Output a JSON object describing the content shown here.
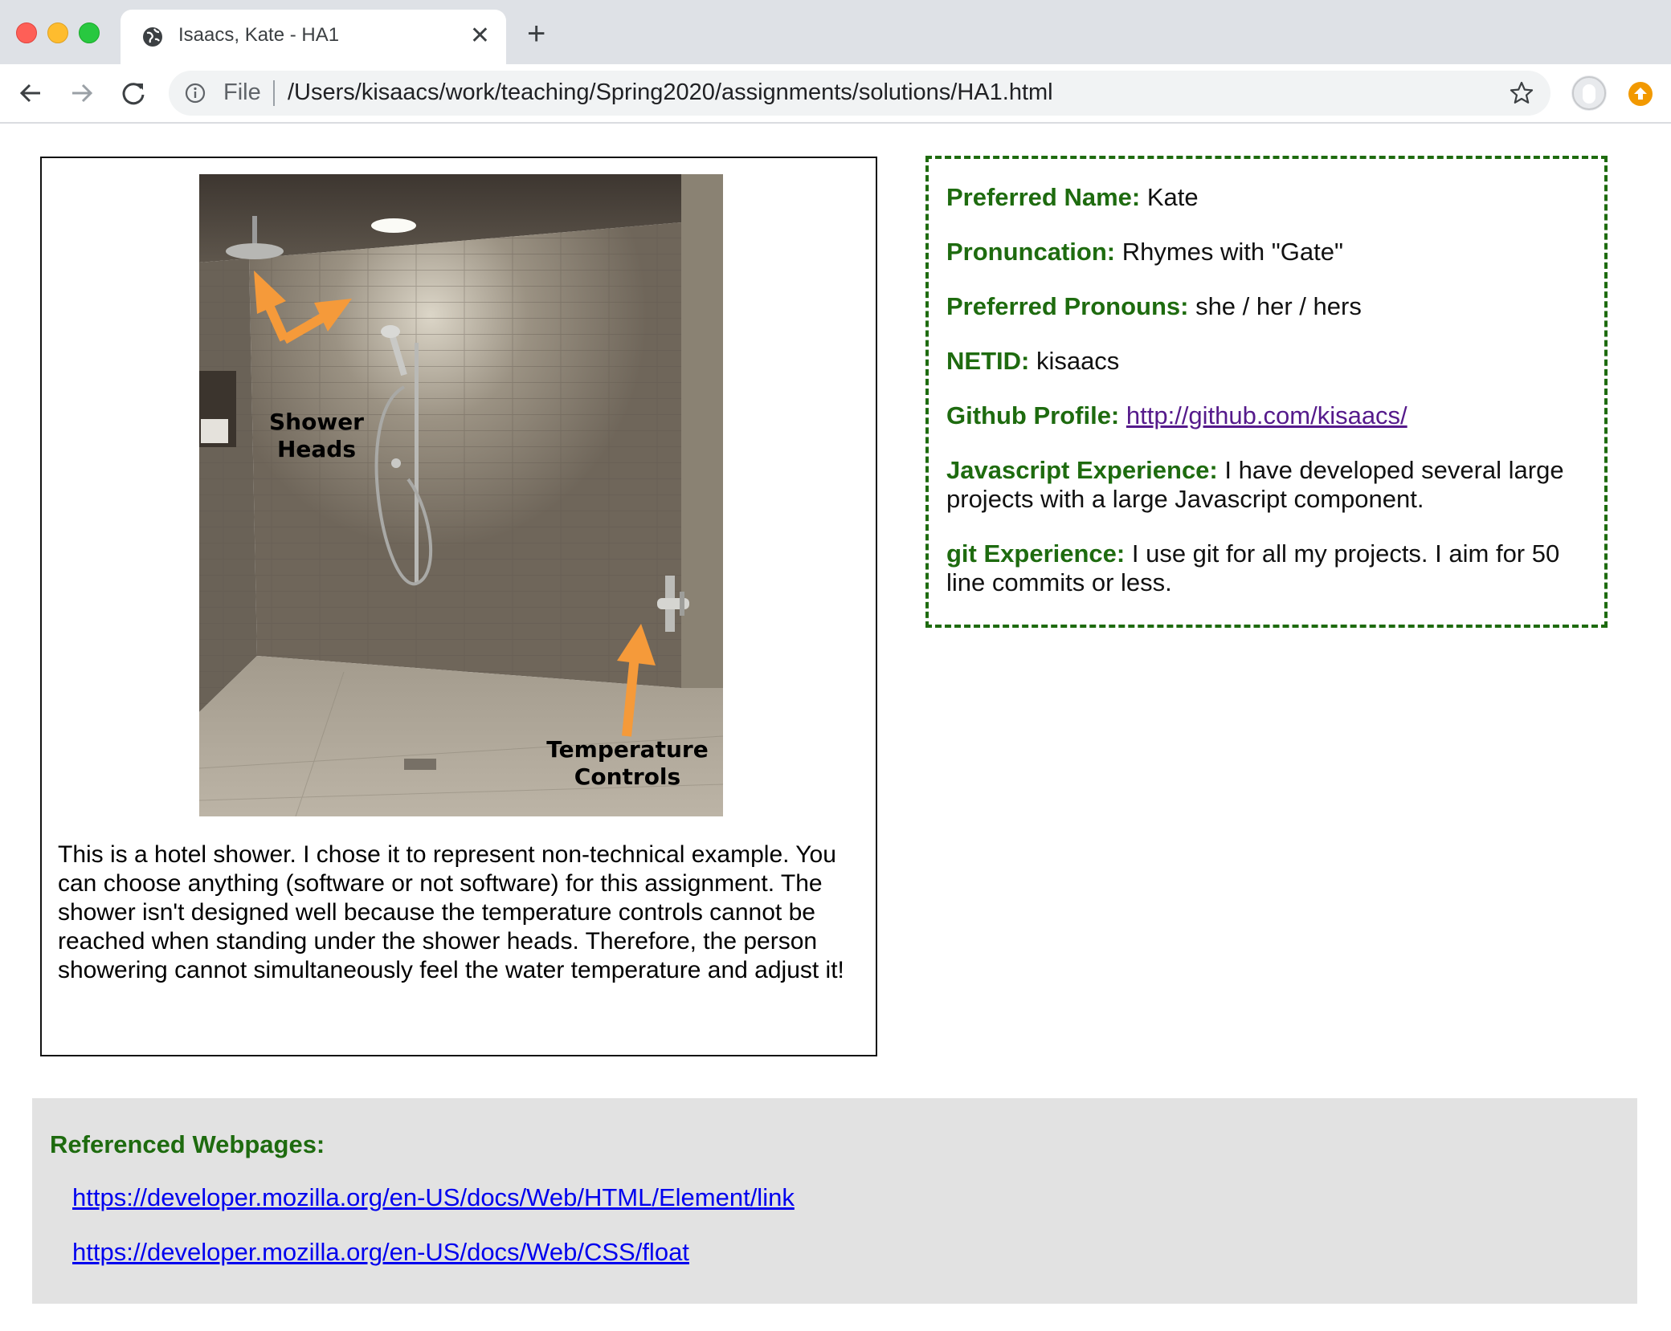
{
  "browser": {
    "tab_title": "Isaacs, Kate - HA1",
    "close_glyph": "✕",
    "new_tab_glyph": "+",
    "address": {
      "scheme_label": "File",
      "url": "/Users/kisaacs/work/teaching/Spring2020/assignments/solutions/HA1.html"
    },
    "icons": [
      "globe-icon",
      "close-icon",
      "plus-icon",
      "back-arrow-icon",
      "forward-arrow-icon",
      "reload-icon",
      "info-icon",
      "star-icon",
      "avatar",
      "update-arrow-icon"
    ]
  },
  "example": {
    "image_labels": {
      "shower_heads": "Shower\nHeads",
      "temperature_controls": "Temperature\nControls"
    },
    "caption": "This is a hotel shower. I chose it to represent non-technical example. You can choose anything (software or not software) for this assignment. The shower isn't designed well because the temperature controls cannot be reached when standing under the shower heads. Therefore, the person showering cannot simultaneously feel the water temperature and adjust it!"
  },
  "profile": {
    "preferred_name": {
      "label": "Preferred Name:",
      "value": " Kate"
    },
    "pronunciation": {
      "label": "Pronuncation:",
      "value": " Rhymes with \"Gate\""
    },
    "pronouns": {
      "label": "Preferred Pronouns:",
      "value": " she / her / hers"
    },
    "netid": {
      "label": "NETID:",
      "value": " kisaacs"
    },
    "github": {
      "label": "Github Profile:",
      "value": "http://github.com/kisaacs/"
    },
    "javascript": {
      "label": "Javascript Experience:",
      "value": " I have developed several large projects with a large Javascript component."
    },
    "git": {
      "label": "git Experience:",
      "value": " I use git for all my projects. I aim for 50 line commits or less."
    }
  },
  "references": {
    "title": "Referenced Webpages:",
    "links": [
      "https://developer.mozilla.org/en-US/docs/Web/HTML/Element/link",
      "https://developer.mozilla.org/en-US/docs/Web/CSS/float"
    ]
  },
  "colors": {
    "accent_green": "#1e6b0f",
    "visited_link": "#551a8b",
    "link": "#0000ee",
    "arrow_orange": "#f59a3a"
  }
}
